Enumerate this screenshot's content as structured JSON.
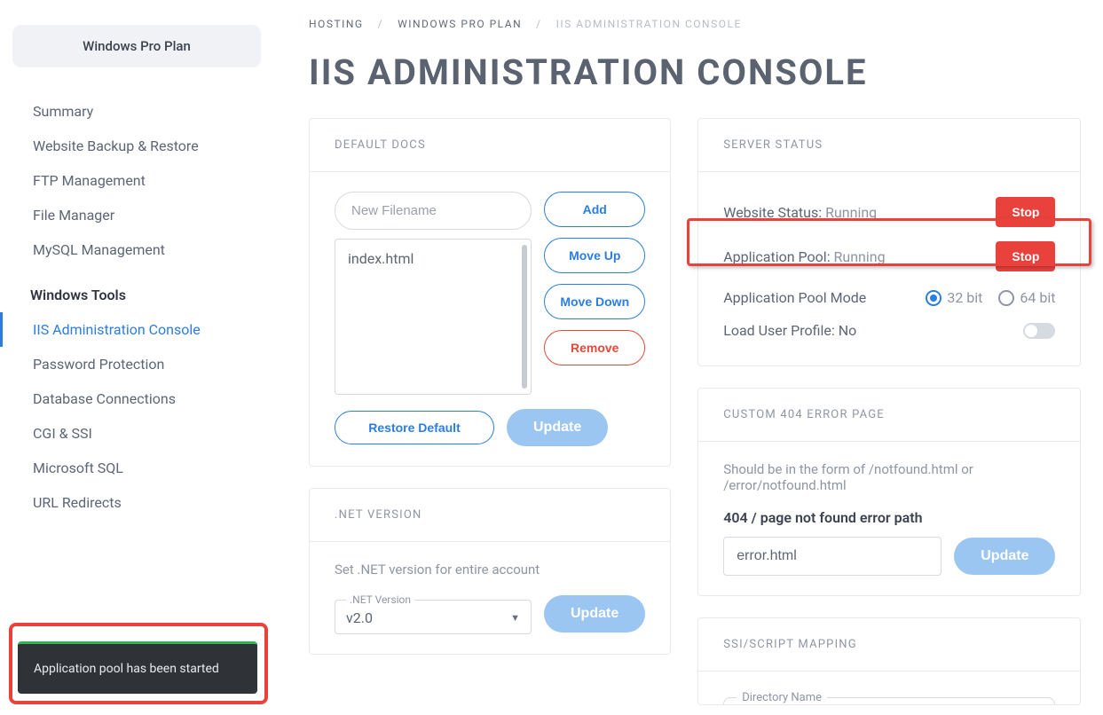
{
  "sidebar": {
    "plan_pill": "Windows Pro Plan",
    "items_top": [
      "Summary",
      "Website Backup & Restore",
      "FTP Management",
      "File Manager",
      "MySQL Management"
    ],
    "heading": "Windows Tools",
    "items_bottom": [
      "IIS Administration Console",
      "Password Protection",
      "Database Connections",
      "CGI & SSI",
      "Microsoft SQL",
      "URL Redirects"
    ],
    "active_index_bottom": 0
  },
  "breadcrumb": {
    "items": [
      "HOSTING",
      "WINDOWS PRO PLAN",
      "IIS ADMINISTRATION CONSOLE"
    ]
  },
  "page_title": "IIS ADMINISTRATION CONSOLE",
  "default_docs": {
    "header": "DEFAULT DOCS",
    "new_filename_placeholder": "New Filename",
    "list": [
      "index.html"
    ],
    "add_btn": "Add",
    "move_up_btn": "Move Up",
    "move_down_btn": "Move Down",
    "remove_btn": "Remove",
    "restore_btn": "Restore Default",
    "update_btn": "Update"
  },
  "net_version": {
    "header": ".NET VERSION",
    "note": "Set .NET version for entire account",
    "field_label": ".NET Version",
    "value": "v2.0",
    "update_btn": "Update"
  },
  "server_status": {
    "header": "SERVER STATUS",
    "website_label": "Website Status:",
    "website_value": "Running",
    "website_btn": "Stop",
    "apppool_label": "Application Pool:",
    "apppool_value": "Running",
    "apppool_btn": "Stop",
    "mode_label": "Application Pool Mode",
    "mode_options": [
      "32 bit",
      "64 bit"
    ],
    "mode_selected": "32 bit",
    "load_profile_label": "Load User Profile:",
    "load_profile_value": "No"
  },
  "custom_404": {
    "header": "CUSTOM 404 ERROR PAGE",
    "note": "Should be in the form of /notfound.html or /error/notfound.html",
    "field_label": "404 / page not found error path",
    "value": "error.html",
    "update_btn": "Update"
  },
  "ssi_mapping": {
    "header": "SSI/SCRIPT MAPPING",
    "field_label": "Directory Name"
  },
  "toast": {
    "message": "Application pool has been started"
  }
}
